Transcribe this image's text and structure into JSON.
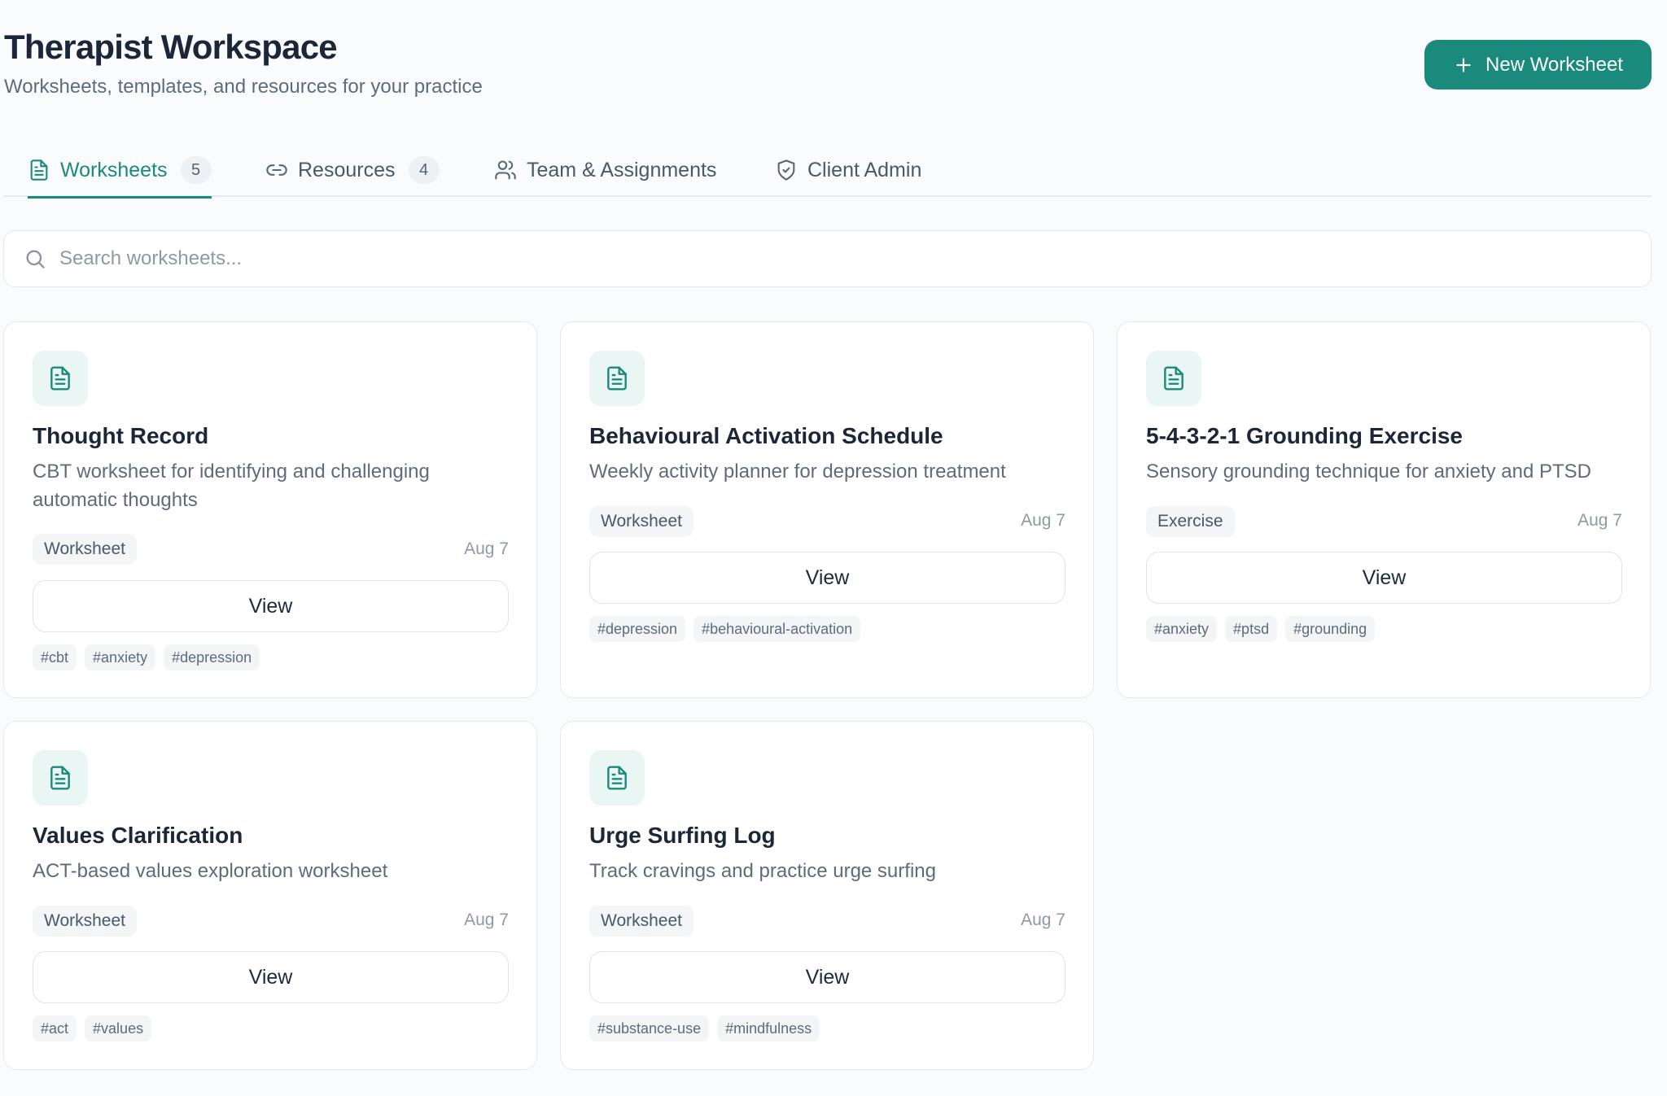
{
  "header": {
    "title": "Therapist Workspace",
    "subtitle": "Worksheets, templates, and resources for your practice",
    "new_button_label": "New Worksheet"
  },
  "tabs": [
    {
      "label": "Worksheets",
      "count": "5",
      "icon": "document-icon",
      "active": true
    },
    {
      "label": "Resources",
      "count": "4",
      "icon": "link-icon",
      "active": false
    },
    {
      "label": "Team & Assignments",
      "count": "",
      "icon": "users-icon",
      "active": false
    },
    {
      "label": "Client Admin",
      "count": "",
      "icon": "shield-check-icon",
      "active": false
    }
  ],
  "search": {
    "placeholder": "Search worksheets...",
    "value": ""
  },
  "cards": [
    {
      "title": "Thought Record",
      "description": "CBT worksheet for identifying and challenging automatic thoughts",
      "type": "Worksheet",
      "date": "Aug 7",
      "view_label": "View",
      "tags": [
        "#cbt",
        "#anxiety",
        "#depression"
      ]
    },
    {
      "title": "Behavioural Activation Schedule",
      "description": "Weekly activity planner for depression treatment",
      "type": "Worksheet",
      "date": "Aug 7",
      "view_label": "View",
      "tags": [
        "#depression",
        "#behavioural-activation"
      ]
    },
    {
      "title": "5-4-3-2-1 Grounding Exercise",
      "description": "Sensory grounding technique for anxiety and PTSD",
      "type": "Exercise",
      "date": "Aug 7",
      "view_label": "View",
      "tags": [
        "#anxiety",
        "#ptsd",
        "#grounding"
      ]
    },
    {
      "title": "Values Clarification",
      "description": "ACT-based values exploration worksheet",
      "type": "Worksheet",
      "date": "Aug 7",
      "view_label": "View",
      "tags": [
        "#act",
        "#values"
      ]
    },
    {
      "title": "Urge Surfing Log",
      "description": "Track cravings and practice urge surfing",
      "type": "Worksheet",
      "date": "Aug 7",
      "view_label": "View",
      "tags": [
        "#substance-use",
        "#mindfulness"
      ]
    }
  ],
  "colors": {
    "accent": "#198a7b",
    "accent_soft": "#e9f6f3",
    "text": "#1b2638",
    "muted": "#5f6b7c"
  }
}
